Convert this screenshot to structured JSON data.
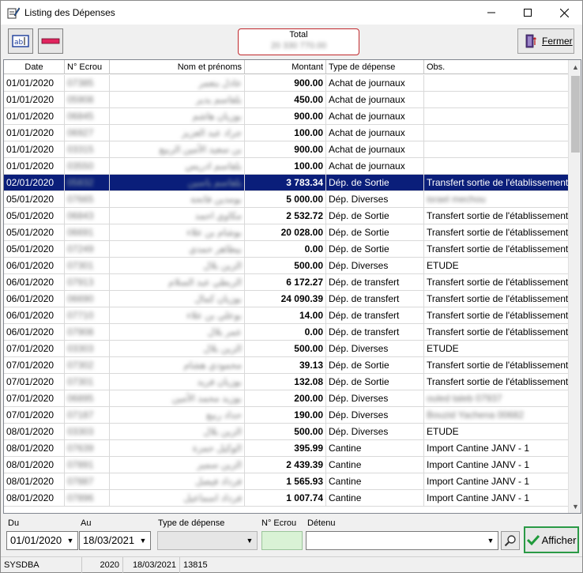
{
  "window": {
    "title": "Listing des Dépenses",
    "controls": [
      "minimize-icon",
      "maximize-icon",
      "close-icon"
    ]
  },
  "toolbar": {
    "total_label": "Total",
    "total_value": "20 330 770.00",
    "fermer_label": "Fermer"
  },
  "grid": {
    "columns": [
      "Date",
      "N° Ecrou",
      "Nom et prénoms",
      "Montant",
      "Type de dépense",
      "Obs."
    ],
    "selected_row": 6,
    "rows": [
      {
        "date": "01/01/2020",
        "ecrou": "07385",
        "nom": "عادل بنعمر",
        "montant": "900.00",
        "type": "Achat de journaux",
        "obs": ""
      },
      {
        "date": "01/01/2020",
        "ecrou": "05908",
        "nom": "بلقاسم يدير",
        "montant": "450.00",
        "type": "Achat de journaux",
        "obs": ""
      },
      {
        "date": "01/01/2020",
        "ecrou": "06845",
        "nom": "بوزيان هاشم",
        "montant": "900.00",
        "type": "Achat de journaux",
        "obs": ""
      },
      {
        "date": "01/01/2020",
        "ecrou": "06927",
        "nom": "جراد عبد العزيز",
        "montant": "100.00",
        "type": "Achat de journaux",
        "obs": ""
      },
      {
        "date": "01/01/2020",
        "ecrou": "03315",
        "nom": "بن سعيد الأمين الربيع",
        "montant": "900.00",
        "type": "Achat de journaux",
        "obs": ""
      },
      {
        "date": "01/01/2020",
        "ecrou": "03550",
        "nom": "بلقاسم ادريس",
        "montant": "100.00",
        "type": "Achat de journaux",
        "obs": ""
      },
      {
        "date": "02/01/2020",
        "ecrou": "05832",
        "nom": "بلقاسم ياسين",
        "montant": "3 783.34",
        "type": "Dép. de Sortie",
        "obs": "Transfert sortie de l'établissement"
      },
      {
        "date": "05/01/2020",
        "ecrou": "07665",
        "nom": "بومدين فاتحة",
        "montant": "5 000.00",
        "type": "Dép. Diverses",
        "obs": "israel mechou"
      },
      {
        "date": "05/01/2020",
        "ecrou": "06843",
        "nom": "مكاوي احمد",
        "montant": "2 532.72",
        "type": "Dép. de Sortie",
        "obs": "Transfert sortie de l'établissement"
      },
      {
        "date": "05/01/2020",
        "ecrou": "06691",
        "nom": "بوشام بن علاء",
        "montant": "20 028.00",
        "type": "Dép. de Sortie",
        "obs": "Transfert sortie de l'établissement"
      },
      {
        "date": "05/01/2020",
        "ecrou": "07249",
        "nom": "بيطاهر حمدي",
        "montant": "0.00",
        "type": "Dép. de Sortie",
        "obs": "Transfert sortie de l'établissement"
      },
      {
        "date": "06/01/2020",
        "ecrou": "07301",
        "nom": "الزين بلال",
        "montant": "500.00",
        "type": "Dép. Diverses",
        "obs": "ETUDE"
      },
      {
        "date": "06/01/2020",
        "ecrou": "07913",
        "nom": "الربطي عبد السلام",
        "montant": "6 172.27",
        "type": "Dép. de transfert",
        "obs": "Transfert sortie de l'établissement"
      },
      {
        "date": "06/01/2020",
        "ecrou": "06690",
        "nom": "بوزيان كمال",
        "montant": "24 090.39",
        "type": "Dép. de transfert",
        "obs": "Transfert sortie de l'établissement"
      },
      {
        "date": "06/01/2020",
        "ecrou": "07710",
        "nom": "بوعلي بن علاء",
        "montant": "14.00",
        "type": "Dép. de transfert",
        "obs": "Transfert sortie de l'établissement"
      },
      {
        "date": "06/01/2020",
        "ecrou": "07908",
        "nom": "عمر بلال",
        "montant": "0.00",
        "type": "Dép. de transfert",
        "obs": "Transfert sortie de l'établissement"
      },
      {
        "date": "07/01/2020",
        "ecrou": "03303",
        "nom": "الزين بلال",
        "montant": "500.00",
        "type": "Dép. Diverses",
        "obs": "ETUDE"
      },
      {
        "date": "07/01/2020",
        "ecrou": "07302",
        "nom": "محمودي هشام",
        "montant": "39.13",
        "type": "Dép. de Sortie",
        "obs": "Transfert sortie de l'établissement"
      },
      {
        "date": "07/01/2020",
        "ecrou": "07301",
        "nom": "بوزيان فريد",
        "montant": "132.08",
        "type": "Dép. de Sortie",
        "obs": "Transfert sortie de l'établissement"
      },
      {
        "date": "07/01/2020",
        "ecrou": "06895",
        "nom": "بوزيد محمد الأمين",
        "montant": "200.00",
        "type": "Dép. Diverses",
        "obs": "ouled taleb 07937"
      },
      {
        "date": "07/01/2020",
        "ecrou": "07187",
        "nom": "حداد ربيع",
        "montant": "190.00",
        "type": "Dép. Diverses",
        "obs": "Bouzid Yachena 00682"
      },
      {
        "date": "08/01/2020",
        "ecrou": "03303",
        "nom": "الزين بلال",
        "montant": "500.00",
        "type": "Dép. Diverses",
        "obs": "ETUDE"
      },
      {
        "date": "08/01/2020",
        "ecrou": "07639",
        "nom": "الوكيل حمزة",
        "montant": "395.99",
        "type": "Cantine",
        "obs": "Import Cantine JANV - 1"
      },
      {
        "date": "08/01/2020",
        "ecrou": "07891",
        "nom": "الزين سمير",
        "montant": "2 439.39",
        "type": "Cantine",
        "obs": "Import Cantine JANV - 1"
      },
      {
        "date": "08/01/2020",
        "ecrou": "07887",
        "nom": "فرداد فيصل",
        "montant": "1 565.93",
        "type": "Cantine",
        "obs": "Import Cantine JANV - 1"
      },
      {
        "date": "08/01/2020",
        "ecrou": "07896",
        "nom": "فرداد اسماعيل",
        "montant": "1 007.74",
        "type": "Cantine",
        "obs": "Import Cantine JANV - 1"
      }
    ]
  },
  "filters": {
    "du_label": "Du",
    "du_value": "01/01/2020",
    "au_label": "Au",
    "au_value": "18/03/2021",
    "type_label": "Type de dépense",
    "type_value": "",
    "ecrou_label": "N° Ecrou",
    "ecrou_value": "",
    "detenu_label": "Détenu",
    "detenu_value": "",
    "afficher_label": "Afficher"
  },
  "statusbar": {
    "user": "SYSDBA",
    "year": "2020",
    "date": "18/03/2021",
    "count": "13815"
  }
}
